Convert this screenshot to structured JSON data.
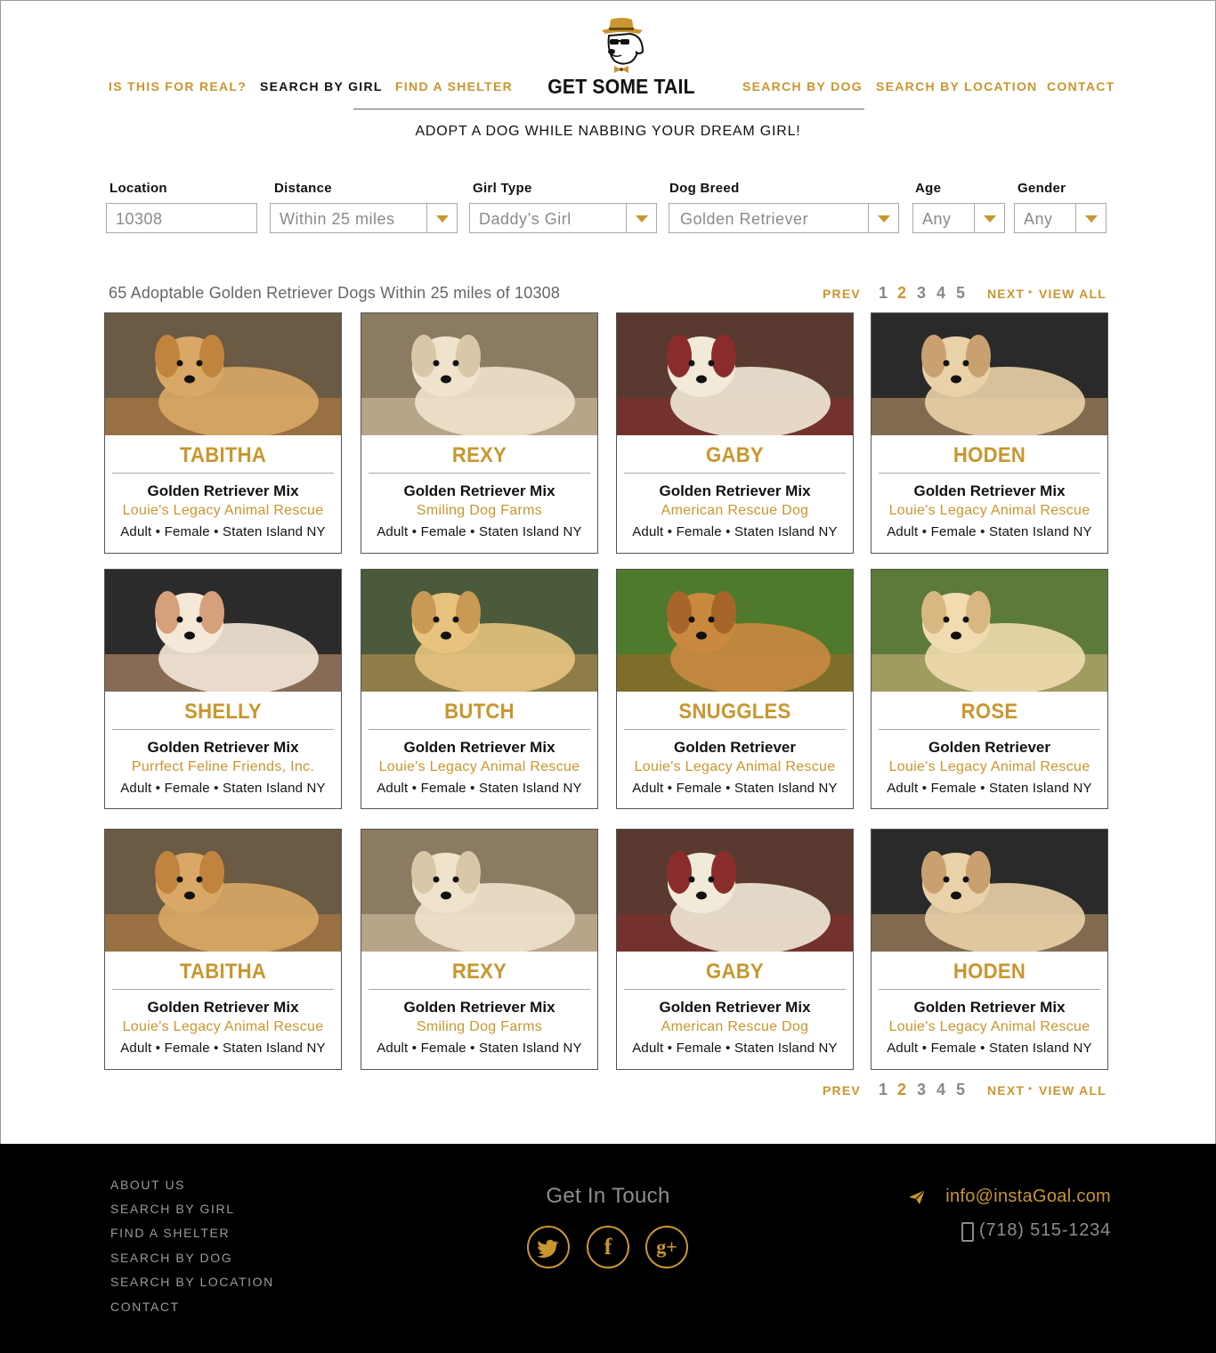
{
  "brand": {
    "name": "GET SOME TAIL",
    "logo_icon": "dog-with-hat-logo-icon"
  },
  "nav": {
    "left": [
      {
        "label": "IS THIS FOR REAL?",
        "active": false
      },
      {
        "label": "SEARCH BY GIRL",
        "active": true
      },
      {
        "label": "FIND A SHELTER",
        "active": false
      }
    ],
    "right": [
      {
        "label": "SEARCH BY DOG",
        "active": false
      },
      {
        "label": "SEARCH BY LOCATION",
        "active": false
      },
      {
        "label": "CONTACT",
        "active": false
      }
    ]
  },
  "tagline": "ADOPT A DOG WHILE NABBING YOUR DREAM GIRL!",
  "filters": {
    "location": {
      "label": "Location",
      "value": "10308"
    },
    "distance": {
      "label": "Distance",
      "value": "Within 25 miles"
    },
    "girl_type": {
      "label": "Girl Type",
      "value": "Daddy’s Girl"
    },
    "dog_breed": {
      "label": "Dog Breed",
      "value": "Golden Retriever"
    },
    "age": {
      "label": "Age",
      "value": "Any"
    },
    "gender": {
      "label": "Gender",
      "value": "Any"
    }
  },
  "results": {
    "summary": "65 Adoptable Golden Retriever Dogs Within 25 miles of 10308"
  },
  "pager": {
    "prev": "PREV",
    "pages": [
      "1",
      "2",
      "3",
      "4",
      "5"
    ],
    "current": "2",
    "next": "NEXT",
    "separator": "•",
    "view_all": "VIEW ALL"
  },
  "dogs": [
    {
      "name": "TABITHA",
      "breed": "Golden Retriever Mix",
      "shelter": "Louie's Legacy Animal Rescue",
      "meta": "Adult • Female • Staten Island NY"
    },
    {
      "name": "REXY",
      "breed": "Golden Retriever Mix",
      "shelter": "Smiling Dog Farms",
      "meta": "Adult • Female • Staten Island NY"
    },
    {
      "name": "GABY",
      "breed": "Golden Retriever Mix",
      "shelter": "American Rescue Dog",
      "meta": "Adult • Female • Staten Island NY"
    },
    {
      "name": "HODEN",
      "breed": "Golden Retriever Mix",
      "shelter": "Louie's Legacy Animal Rescue",
      "meta": "Adult • Female • Staten Island NY"
    },
    {
      "name": "SHELLY",
      "breed": "Golden Retriever Mix",
      "shelter": "Purrfect Feline Friends, Inc.",
      "meta": "Adult • Female • Staten Island NY"
    },
    {
      "name": "BUTCH",
      "breed": "Golden Retriever Mix",
      "shelter": "Louie's Legacy Animal Rescue",
      "meta": "Adult • Female • Staten Island NY"
    },
    {
      "name": "SNUGGLES",
      "breed": "Golden Retriever",
      "shelter": "Louie's Legacy Animal Rescue",
      "meta": "Adult • Female • Staten Island NY"
    },
    {
      "name": "ROSE",
      "breed": "Golden Retriever",
      "shelter": "Louie's Legacy Animal Rescue",
      "meta": "Adult • Female • Staten Island NY"
    },
    {
      "name": "TABITHA",
      "breed": "Golden Retriever Mix",
      "shelter": "Louie's Legacy Animal Rescue",
      "meta": "Adult • Female • Staten Island NY"
    },
    {
      "name": "REXY",
      "breed": "Golden Retriever Mix",
      "shelter": "Smiling Dog Farms",
      "meta": "Adult • Female • Staten Island NY"
    },
    {
      "name": "GABY",
      "breed": "Golden Retriever Mix",
      "shelter": "American Rescue Dog",
      "meta": "Adult • Female • Staten Island NY"
    },
    {
      "name": "HODEN",
      "breed": "Golden Retriever Mix",
      "shelter": "Louie's Legacy Animal Rescue",
      "meta": "Adult • Female • Staten Island NY"
    }
  ],
  "footer": {
    "links": [
      "ABOUT US",
      "SEARCH BY GIRL",
      "FIND A SHELTER",
      "SEARCH BY DOG",
      "SEARCH BY  LOCATION",
      "CONTACT"
    ],
    "get_in_touch": "Get In Touch",
    "social": [
      {
        "icon": "twitter-icon",
        "glyph": "t"
      },
      {
        "icon": "facebook-icon",
        "glyph": "f"
      },
      {
        "icon": "google-plus-icon",
        "glyph": "g+"
      }
    ],
    "email": "info@instaGoal.com",
    "phone": "(718) 515-1234"
  },
  "colors": {
    "accent": "#c9962f",
    "text": "#111111",
    "footer_bg": "#000000",
    "muted": "#8d8d8d"
  }
}
